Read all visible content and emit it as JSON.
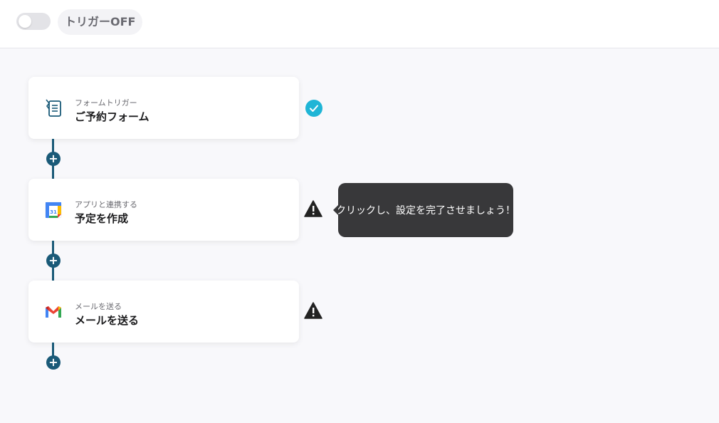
{
  "header": {
    "trigger_toggle_state": "off",
    "trigger_status_label": "トリガーOFF"
  },
  "flow": {
    "steps": [
      {
        "subtitle": "フォームトリガー",
        "title": "ご予約フォーム",
        "icon": "form-icon",
        "status": "complete"
      },
      {
        "subtitle": "アプリと連携する",
        "title": "予定を作成",
        "icon": "google-calendar-icon",
        "status": "warning"
      },
      {
        "subtitle": "メールを送る",
        "title": "メールを送る",
        "icon": "gmail-icon",
        "status": "warning"
      }
    ],
    "add_step_symbol": "+"
  },
  "tooltip": {
    "text": "クリックし、設定を完了させましょう！"
  },
  "colors": {
    "connector": "#1a5a78",
    "complete": "#1fb5d6",
    "warning": "#222222",
    "tooltip_bg": "#38383a"
  }
}
